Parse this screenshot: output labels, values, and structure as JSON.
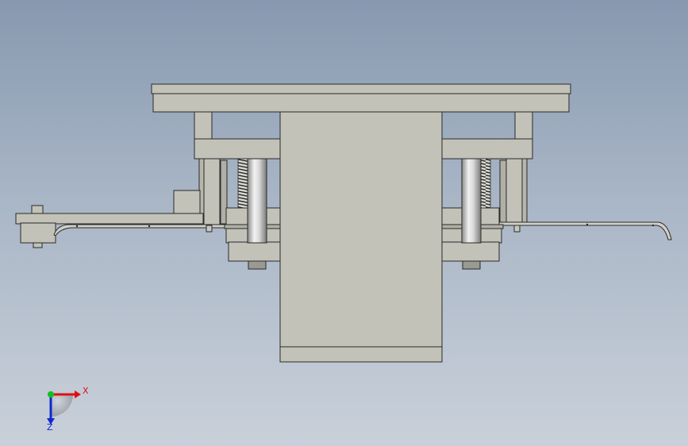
{
  "triad": {
    "x_label": "X",
    "z_label": "Z"
  },
  "colors": {
    "part_fill": "#c2c2b8",
    "part_shade": "#a9a9a0",
    "edge": "#2a2a2a",
    "x_axis": "#e01010",
    "y_axis": "#10c020",
    "z_axis": "#1028d0"
  }
}
